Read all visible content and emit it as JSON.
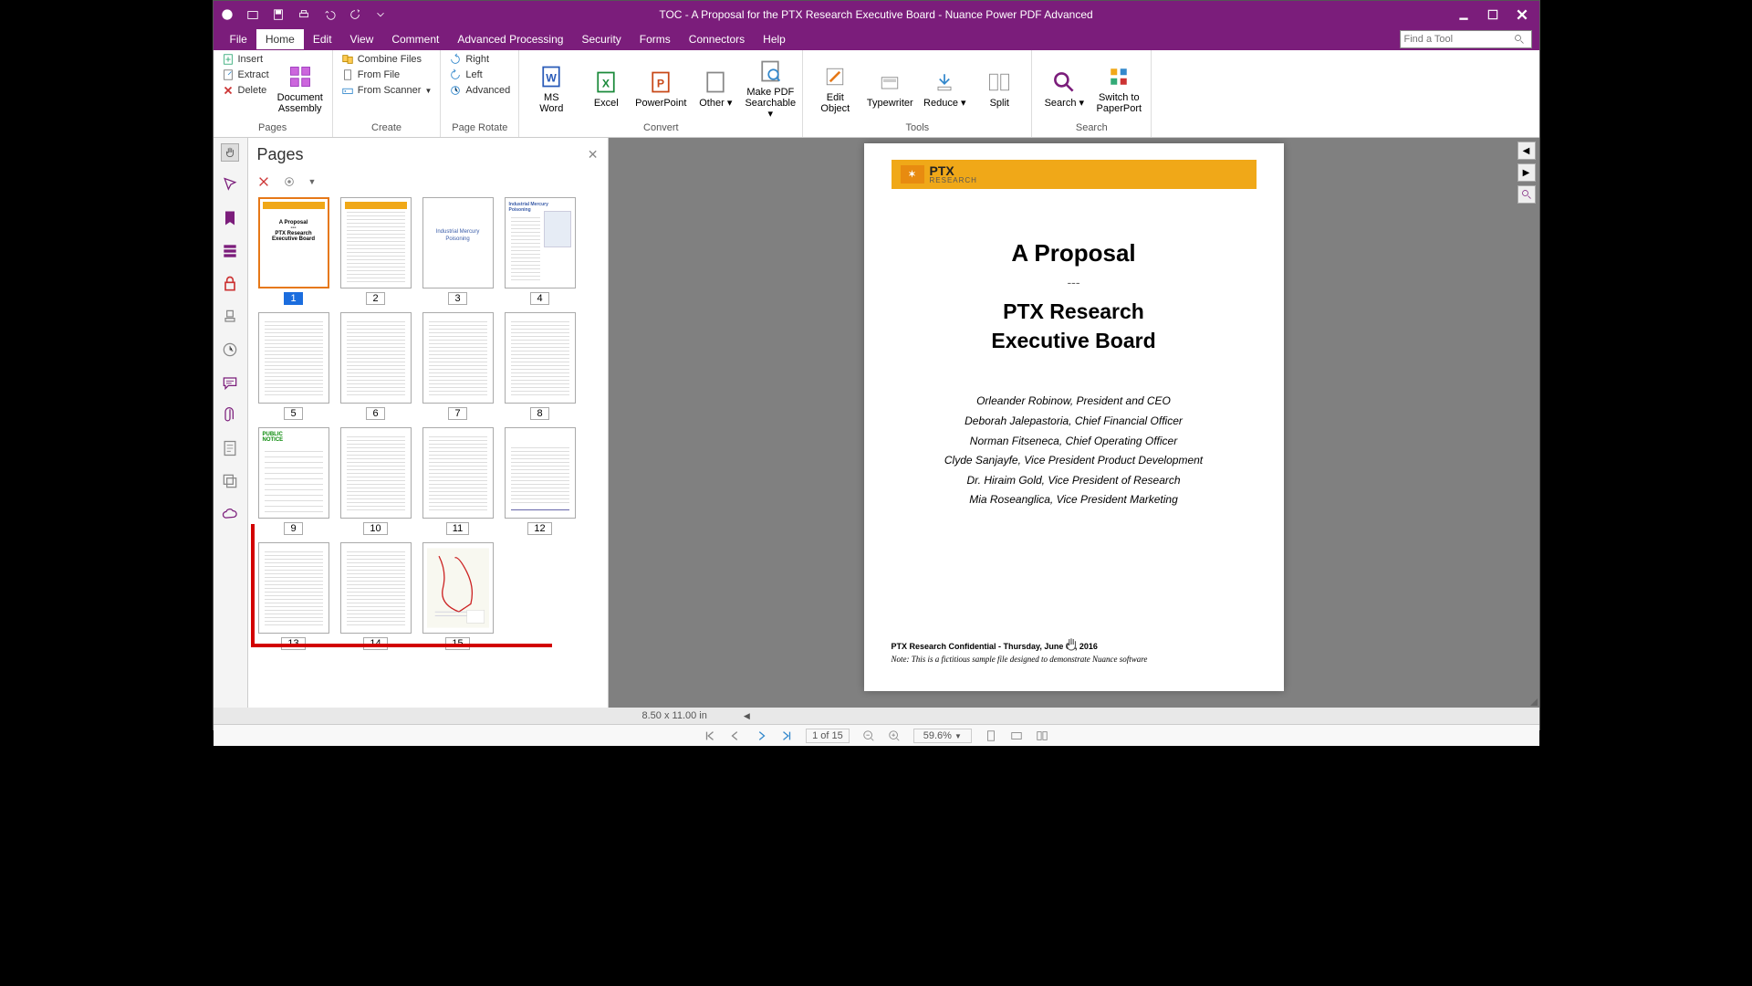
{
  "title": "TOC - A Proposal for the PTX Research Executive Board - Nuance Power PDF Advanced",
  "menu": {
    "file": "File",
    "home": "Home",
    "edit": "Edit",
    "view": "View",
    "comment": "Comment",
    "advanced": "Advanced Processing",
    "security": "Security",
    "forms": "Forms",
    "connectors": "Connectors",
    "help": "Help"
  },
  "find_placeholder": "Find a Tool",
  "ribbon": {
    "pages": {
      "insert": "Insert",
      "extract": "Extract",
      "delete": "Delete",
      "assembly": "Document\nAssembly",
      "group": "Pages"
    },
    "create": {
      "combine": "Combine Files",
      "fromfile": "From File",
      "scanner": "From Scanner",
      "group": "Create"
    },
    "rotate": {
      "right": "Right",
      "left": "Left",
      "advanced": "Advanced",
      "group": "Page Rotate"
    },
    "convert": {
      "word": "MS\nWord",
      "excel": "Excel",
      "ppt": "PowerPoint",
      "other": "Other",
      "makepdf": "Make PDF\nSearchable",
      "group": "Convert"
    },
    "tools": {
      "editobj": "Edit\nObject",
      "typewriter": "Typewriter",
      "reduce": "Reduce",
      "split": "Split",
      "group": "Tools"
    },
    "search": {
      "search": "Search",
      "switch": "Switch to\nPaperPort",
      "group": "Search"
    }
  },
  "pages_panel": {
    "title": "Pages"
  },
  "page_count": 15,
  "selected_page": 1,
  "document": {
    "brand": "PTX",
    "brand_sub": "RESEARCH",
    "title1": "A Proposal",
    "title2": "PTX Research\nExecutive Board",
    "names": [
      "Orleander Robinow, President and CEO",
      "Deborah Jalepastoria, Chief Financial Officer",
      "Norman Fitseneca, Chief Operating Officer",
      "Clyde Sanjayfe, Vice President Product Development",
      "Dr. Hiraim Gold, Vice President of Research",
      "Mia Roseanglica, Vice President Marketing"
    ],
    "conf": "PTX Research Confidential - Thursday, June 09, 2016",
    "note": "Note: This is a fictitious sample file designed to demonstrate Nuance software"
  },
  "dimensions": "8.50 x 11.00 in",
  "status": {
    "page": "1 of 15",
    "zoom": "59.6%"
  },
  "thumbs": {
    "p3_text": "Industrial Mercury\nPoisoning",
    "p9_text": "PUBLIC\nNOTICE"
  }
}
